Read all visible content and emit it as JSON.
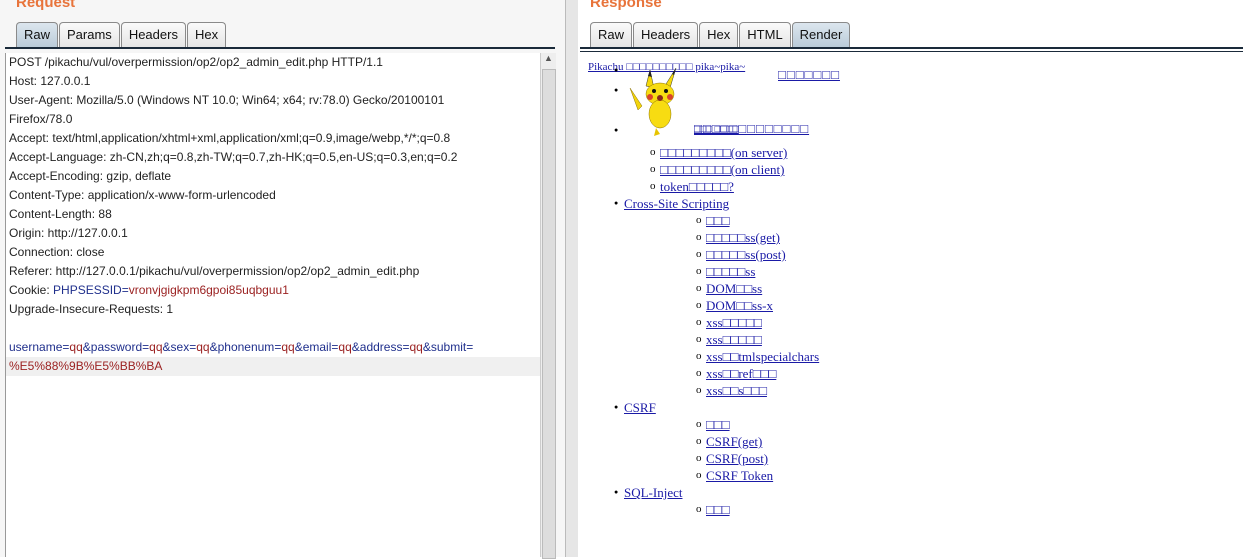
{
  "request": {
    "title": "Request",
    "tabs": [
      "Raw",
      "Params",
      "Headers",
      "Hex"
    ],
    "active_tab": "Raw",
    "lines": [
      "POST /pikachu/vul/overpermission/op2/op2_admin_edit.php HTTP/1.1",
      "Host: 127.0.0.1",
      "User-Agent: Mozilla/5.0 (Windows NT 10.0; Win64; x64; rv:78.0) Gecko/20100101",
      "Firefox/78.0",
      "Accept: text/html,application/xhtml+xml,application/xml;q=0.9,image/webp,*/*;q=0.8",
      "Accept-Language: zh-CN,zh;q=0.8,zh-TW;q=0.7,zh-HK;q=0.5,en-US;q=0.3,en;q=0.2",
      "Accept-Encoding: gzip, deflate",
      "Content-Type: application/x-www-form-urlencoded",
      "Content-Length: 88",
      "Origin: http://127.0.0.1",
      "Connection: close",
      "Referer: http://127.0.0.1/pikachu/vul/overpermission/op2/op2_admin_edit.php"
    ],
    "cookie": {
      "label": "Cookie: ",
      "name": "PHPSESSID",
      "eq": "=",
      "value": "vronvjgigkpm6gpoi85uqbguu1"
    },
    "upgrade": "Upgrade-Insecure-Requests: 1",
    "body": [
      [
        "username",
        "qq"
      ],
      [
        "password",
        "qq"
      ],
      [
        "sex",
        "qq"
      ],
      [
        "phonenum",
        "qq"
      ],
      [
        "email",
        "qq"
      ],
      [
        "address",
        "qq"
      ],
      [
        "submit",
        ""
      ]
    ],
    "body_cont": "%E5%88%9B%E5%BB%BA"
  },
  "response": {
    "title": "Response",
    "tabs": [
      "Raw",
      "Headers",
      "Hex",
      "HTML",
      "Render"
    ],
    "active_tab": "Render",
    "header_link": "Pikachu □□□□□□□□□□ pika~pika~",
    "header_link2": "□□□□□□□",
    "overlap_link": "□□□□□□□□□□□□□",
    "overlap_ghost": "□□□ □□□□",
    "sections": [
      {
        "label": null,
        "items": [
          "□□□□□□□□□(on server)",
          "□□□□□□□□□(on client)",
          "token□□□□□?"
        ]
      },
      {
        "label": "Cross-Site Scripting",
        "items": [
          "□□□",
          "□□□□□ss(get)",
          "□□□□□ss(post)",
          "□□□□□ss",
          "DOM□□ss",
          "DOM□□ss-x",
          "xss□□□□□",
          "xss□□□□□",
          "xss□□tmlspecialchars",
          "xss□□ref□□□",
          "xss□□s□□□"
        ]
      },
      {
        "label": "CSRF",
        "items": [
          "□□□",
          "CSRF(get)",
          "CSRF(post)",
          "CSRF Token"
        ]
      },
      {
        "label": "SQL-Inject",
        "items": [
          "□□□"
        ]
      }
    ]
  }
}
